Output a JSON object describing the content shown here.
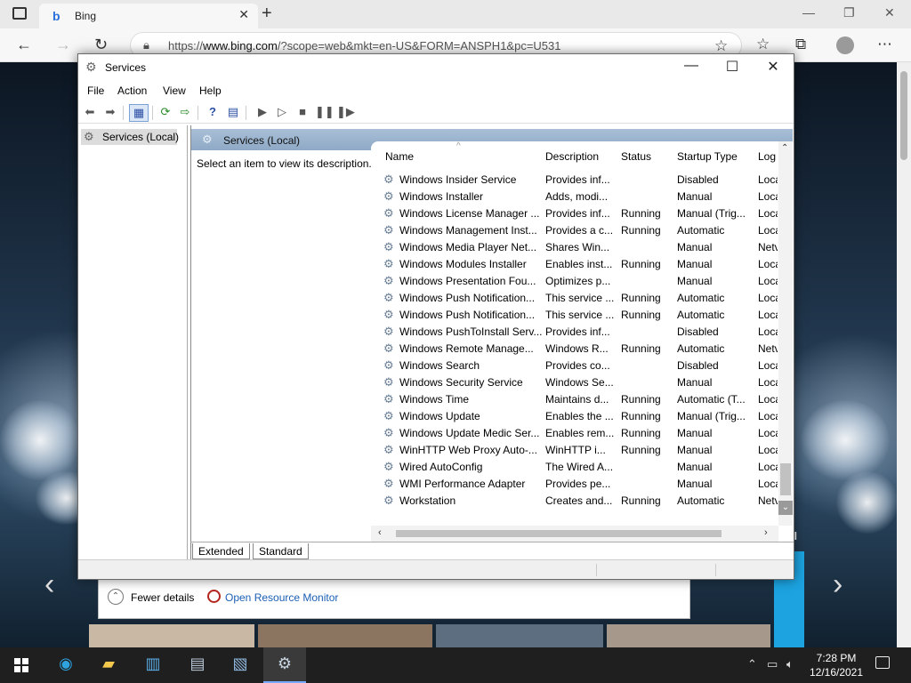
{
  "browser": {
    "tab_title": "Bing",
    "url_prefix": "https://",
    "url_host": "www.bing.com",
    "url_path": "/?scope=web&mkt=en-US&FORM=ANSPH1&pc=U531"
  },
  "services_window": {
    "title": "Services",
    "menu": [
      "File",
      "Action",
      "View",
      "Help"
    ],
    "tree_root": "Services (Local)",
    "pane_header": "Services (Local)",
    "description_prompt": "Select an item to view its description.",
    "columns": [
      "Name",
      "Description",
      "Status",
      "Startup Type",
      "Log"
    ],
    "rows": [
      {
        "name": "Windows Insider Service",
        "description": "Provides inf...",
        "status": "",
        "startup": "Disabled",
        "log": "Loca"
      },
      {
        "name": "Windows Installer",
        "description": "Adds, modi...",
        "status": "",
        "startup": "Manual",
        "log": "Loca"
      },
      {
        "name": "Windows License Manager ...",
        "description": "Provides inf...",
        "status": "Running",
        "startup": "Manual (Trig...",
        "log": "Loca"
      },
      {
        "name": "Windows Management Inst...",
        "description": "Provides a c...",
        "status": "Running",
        "startup": "Automatic",
        "log": "Loca"
      },
      {
        "name": "Windows Media Player Net...",
        "description": "Shares Win...",
        "status": "",
        "startup": "Manual",
        "log": "Netv"
      },
      {
        "name": "Windows Modules Installer",
        "description": "Enables inst...",
        "status": "Running",
        "startup": "Manual",
        "log": "Loca"
      },
      {
        "name": "Windows Presentation Fou...",
        "description": "Optimizes p...",
        "status": "",
        "startup": "Manual",
        "log": "Loca"
      },
      {
        "name": "Windows Push Notification...",
        "description": "This service ...",
        "status": "Running",
        "startup": "Automatic",
        "log": "Loca"
      },
      {
        "name": "Windows Push Notification...",
        "description": "This service ...",
        "status": "Running",
        "startup": "Automatic",
        "log": "Loca"
      },
      {
        "name": "Windows PushToInstall Serv...",
        "description": "Provides inf...",
        "status": "",
        "startup": "Disabled",
        "log": "Loca"
      },
      {
        "name": "Windows Remote Manage...",
        "description": "Windows R...",
        "status": "Running",
        "startup": "Automatic",
        "log": "Netv"
      },
      {
        "name": "Windows Search",
        "description": "Provides co...",
        "status": "",
        "startup": "Disabled",
        "log": "Loca"
      },
      {
        "name": "Windows Security Service",
        "description": "Windows Se...",
        "status": "",
        "startup": "Manual",
        "log": "Loca"
      },
      {
        "name": "Windows Time",
        "description": "Maintains d...",
        "status": "Running",
        "startup": "Automatic (T...",
        "log": "Loca"
      },
      {
        "name": "Windows Update",
        "description": "Enables the ...",
        "status": "Running",
        "startup": "Manual (Trig...",
        "log": "Loca"
      },
      {
        "name": "Windows Update Medic Ser...",
        "description": "Enables rem...",
        "status": "Running",
        "startup": "Manual",
        "log": "Loca"
      },
      {
        "name": "WinHTTP Web Proxy Auto-...",
        "description": "WinHTTP i...",
        "status": "Running",
        "startup": "Manual",
        "log": "Loca"
      },
      {
        "name": "Wired AutoConfig",
        "description": "The Wired A...",
        "status": "",
        "startup": "Manual",
        "log": "Loca"
      },
      {
        "name": "WMI Performance Adapter",
        "description": "Provides pe...",
        "status": "",
        "startup": "Manual",
        "log": "Loca"
      },
      {
        "name": "Workstation",
        "description": "Creates and...",
        "status": "Running",
        "startup": "Automatic",
        "log": "Netv"
      }
    ],
    "view_tabs": [
      "Extended",
      "Standard"
    ]
  },
  "task_manager": {
    "fewer_details": "Fewer details",
    "open_resource_monitor": "Open Resource Monitor",
    "stray_label": "el"
  },
  "taskbar": {
    "time": "7:28 PM",
    "date": "12/16/2021"
  },
  "colors": {
    "pane_header": "#8ea9c6",
    "taskbar": "#1f1f1f",
    "link": "#1a5fb4"
  }
}
